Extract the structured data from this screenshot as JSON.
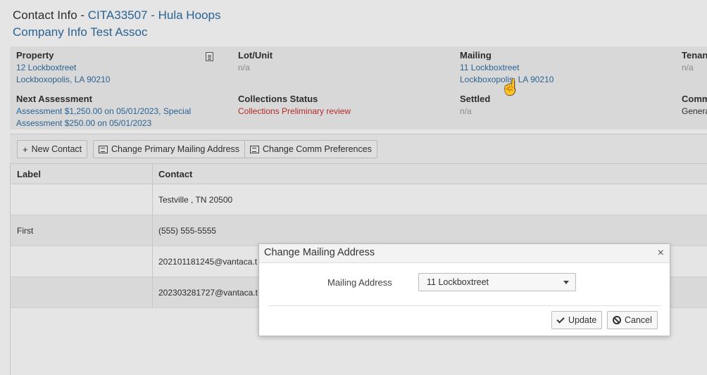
{
  "header": {
    "prefix": "Contact Info - ",
    "account": "CITA33507 - Hula Hoops",
    "company": "Company Info Test Assoc"
  },
  "info": {
    "property": {
      "label": "Property",
      "line1": "12 Lockboxtreet",
      "line2": "Lockboxopolis, LA 90210"
    },
    "lot_unit": {
      "label": "Lot/Unit",
      "value": "n/a"
    },
    "mailing": {
      "label": "Mailing",
      "line1": "11 Lockboxtreet",
      "line2": "Lockboxopolis, LA 90210"
    },
    "tenant": {
      "label": "Tenan",
      "value": "n/a"
    },
    "next_assessment": {
      "label": "Next Assessment",
      "line1": "Assessment $1,250.00 on 05/01/2023, Special",
      "line2": "Assessment $250.00 on 05/01/2023"
    },
    "collections": {
      "label": "Collections Status",
      "value": "Collections Preliminary review"
    },
    "settled": {
      "label": "Settled",
      "value": "n/a"
    },
    "comm": {
      "label": "Comm",
      "value": "Genera"
    }
  },
  "toolbar": {
    "new_contact": "New Contact",
    "change_mailing": "Change Primary Mailing Address",
    "change_comm": "Change Comm Preferences"
  },
  "grid": {
    "columns": [
      "Label",
      "Contact"
    ],
    "rows": [
      {
        "label": "",
        "contact": "Testville , TN 20500"
      },
      {
        "label": "First",
        "contact": "(555) 555-5555"
      },
      {
        "label": "",
        "contact": "202101181245@vantaca.t"
      },
      {
        "label": "",
        "contact": "202303281727@vantaca.t"
      }
    ]
  },
  "modal": {
    "title": "Change Mailing Address",
    "close": "×",
    "field_label": "Mailing Address",
    "selected": "11 Lockboxtreet",
    "update": "Update",
    "cancel": "Cancel"
  }
}
